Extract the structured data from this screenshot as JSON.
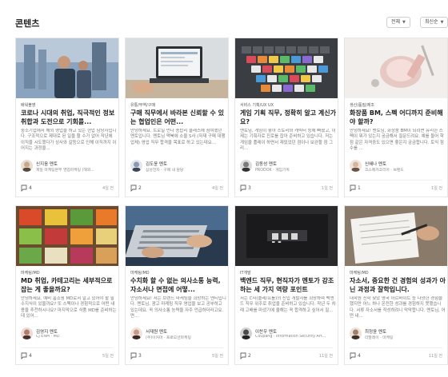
{
  "header": {
    "title": "콘텐츠",
    "filter_label": "전체",
    "sort_label": "최신순"
  },
  "cards": [
    {
      "category": "배워볼영",
      "title": "코로나 시대의 취업, 직극적인 정보 취합과 도전으로 기회를...",
      "desc": "중소기업에서 해외 영업을 하고 있는 현업 담당자입니다. 구조적으로 제대로 된 일을 할 수가 없어 작년에 이직을 시도했다가 상사와 갈등으로 인해 이직까지 이어지는 과정을...",
      "author": "신지웅 멘토",
      "role": "제일 마케팅본부 영업마케팅 (해외...",
      "count": "4",
      "date": "4일 전",
      "avatar": "#c9a88a"
    },
    {
      "category": "유통/무역/구매",
      "title": "구매 직무에서 바라본 신뢰할 수 있는 협업인은 어떤...",
      "desc": "안녕하세요. 트로일 먼다 종합리 클래스에 참여했던 멘토입니다. 멘토님 맥북에 소울 S사 (자재 구매 대행업체) 영업 직무 합격을 목표로 하고 있는데요...",
      "author": "김도윤 멘토",
      "role": "삼성전자 · 구매 내 담당",
      "count": "2",
      "date": "4일 전",
      "avatar": "#8a9ab0"
    },
    {
      "category": "서비스 기획/UX UX",
      "title": "게임 기획 직무, 정확히 알고 계신가요?",
      "desc": "멘토님, 게임이 좋아 스토리와 캐릭터 등에 빠졌고, 이제는 기획자로 진로를 잡아 준비하고 있습니다. 저는 게임을 플레이 하면서 재밌었던 점이나 보완할 점 그리...",
      "author": "김동성 멘토",
      "role": "PRODOK · 게임기획",
      "count": "3",
      "date": "1일 전",
      "avatar": "#7b7b7b"
    },
    {
      "category": "생산/품질/제조",
      "title": "화장품 BM, 스펙 어디까지 준비해야 할까?",
      "desc": "안녕하세요! 멘토님, 화장품 BM이 되려면 유리한 스펙이 뭐가 있는지 궁금해서 질문드려요. 예를 들어 학점 같은 자격증도 있으면 좋은지 궁금합니다. 토익 점수를 ...",
      "author": "신혜나 멘토",
      "role": "코스메카코리아 · 브랜드",
      "count": "1",
      "date": "1일 전",
      "avatar": "#d6b59c"
    },
    {
      "category": "마케팅/MD",
      "title": "MD 취업, 카테고리는 세부적으로 잡는 게 좋을까요?",
      "desc": "안녕하세요. 예비 홈쇼핑 MD로서 알고 있어야 할 필수지식이 있을까요? 또 스펙이나 경험적으로 어떤 내용을 추천하시나요? 마지막으로 식품 MD를 준비하는 데 있어...",
      "author": "김영지 멘토",
      "role": "CJ ENM · MD",
      "count": "4",
      "date": "5일 전",
      "avatar": "#b47a6a"
    },
    {
      "category": "마케팅/MD",
      "title": "수치화 할 수 없는 의사소통 능력, 자소서나 면접에 어떻...",
      "desc": "안녕하세요! 저는 브랜드 마케팅을 희망하는 멘티입니다. 멘토님, 광고 마케팅 직무 영업을 보고 공부하고 있는데요. 꼭 의사소통 능력을 자주 언급하더라고요. 면...",
      "author": "서재원 멘토",
      "role": "(주)이커머 · 프로모션마케팅",
      "count": "3",
      "date": "5일 전",
      "avatar": "#c79a85"
    },
    {
      "category": "IT개발",
      "title": "백엔드 직무, 현직자가 멘토가 강조하는 세 가지 역량 포인트",
      "desc": "저는 C사(플레/프롤)의 신입 개발자를 희망하며 백엔드 직무 위주로 취업을 준비하고 있습니다. 작년 두 차례 고배를 마셨기에 올해는 꼭 합격하고 싶어서 질...",
      "author": "이찬우 멘토",
      "role": "Coupang · Information Security Art...",
      "count": "2",
      "date": "11일 전",
      "avatar": "#4a4a4a"
    },
    {
      "category": "마케팅/MD",
      "title": "자소서, 중요한 건 경험의 성과가 아닌 과정과 잘학입니다.",
      "desc": "대학원 진학 찾았 영국 아르바이트 등 다양한 경험을 했지만 어느 하나 온전한 성과를 경험하지 못했습니다. 서류 자소서를 작성하려니 막막합니다. 멘토님, 어떤 내...",
      "author": "최정윤 멘토",
      "role": "더말레이 · 마케팅",
      "count": "4",
      "date": "11일 전",
      "avatar": "#a0806b"
    }
  ]
}
